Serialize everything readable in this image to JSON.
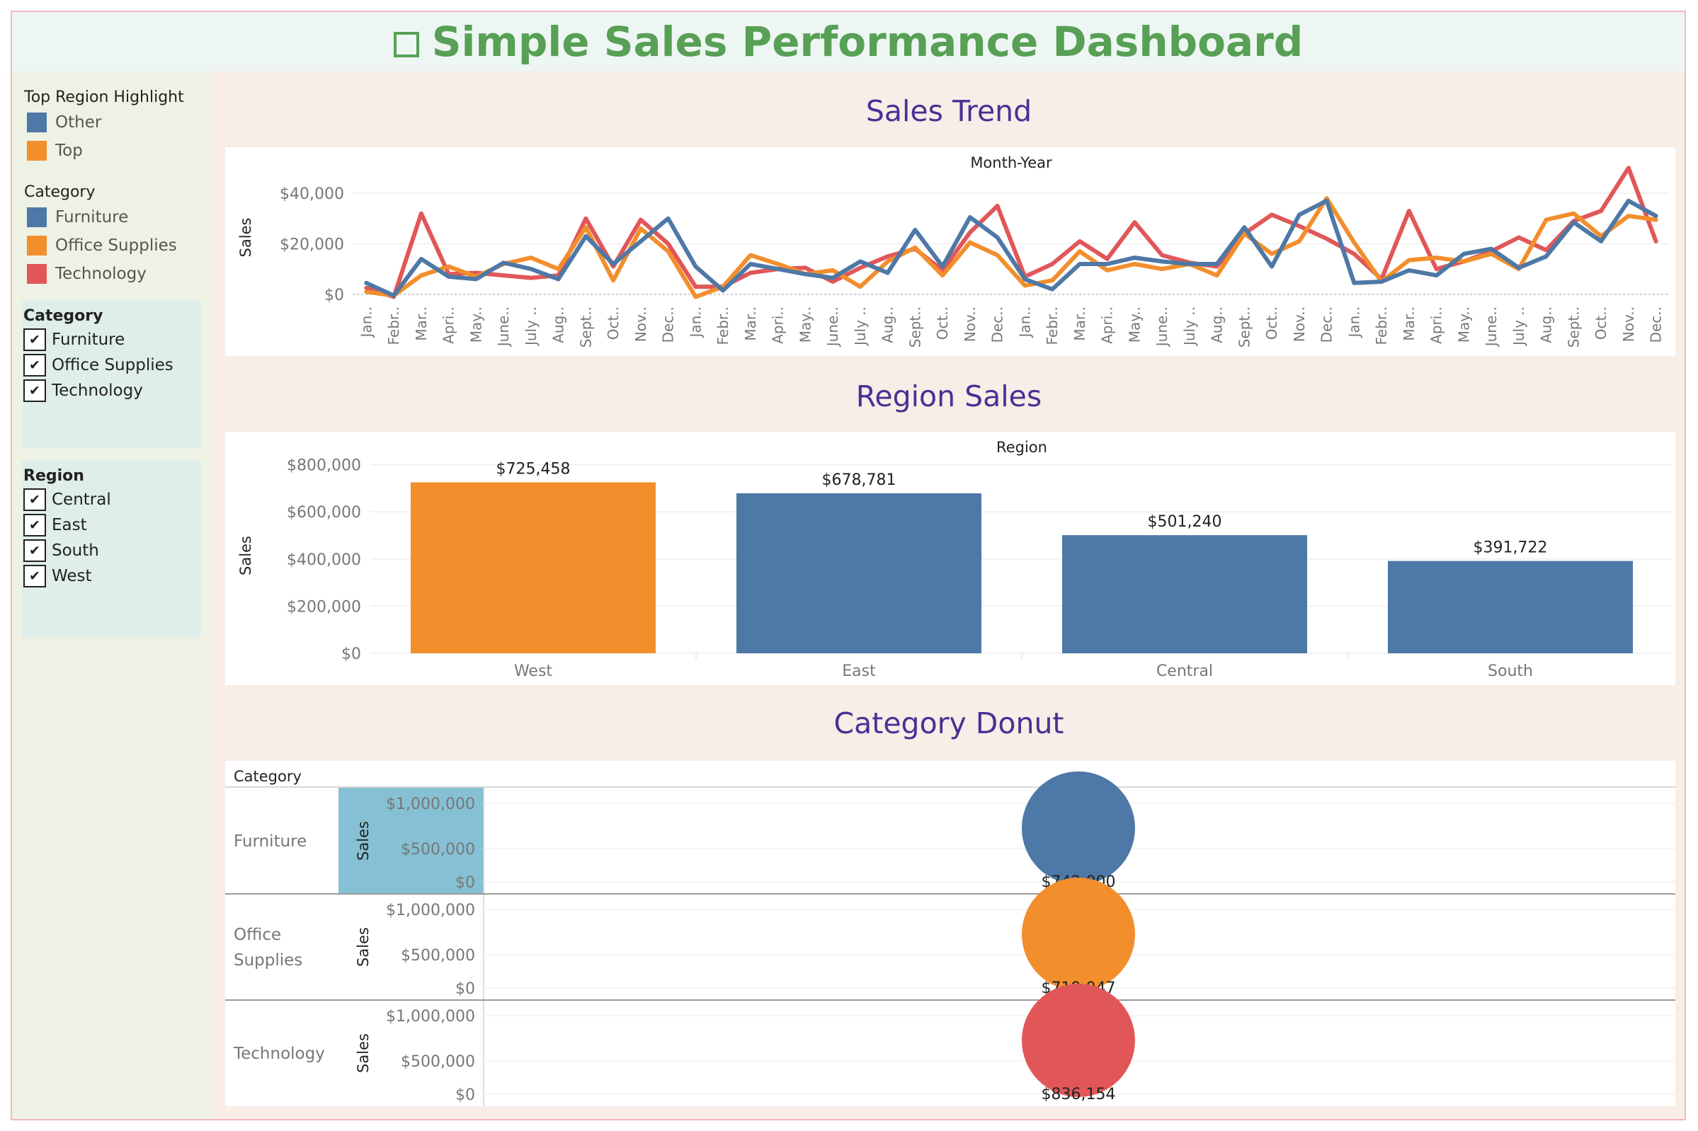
{
  "header": {
    "title": "Simple Sales Performance Dashboard",
    "icon": "checkbox-icon"
  },
  "sidebar": {
    "highlight_legend": {
      "title": "Top Region Highlight",
      "items": [
        {
          "label": "Other",
          "color": "#4e78a6"
        },
        {
          "label": "Top",
          "color": "#f28e2c"
        }
      ]
    },
    "category_legend": {
      "title": "Category",
      "items": [
        {
          "label": "Furniture",
          "color": "#4e78a6"
        },
        {
          "label": "Office Supplies",
          "color": "#f28e2c"
        },
        {
          "label": "Technology",
          "color": "#e15759"
        }
      ]
    },
    "category_filter": {
      "title": "Category",
      "items": [
        {
          "label": "Furniture",
          "checked": true
        },
        {
          "label": "Office Supplies",
          "checked": true
        },
        {
          "label": "Technology",
          "checked": true
        }
      ]
    },
    "region_filter": {
      "title": "Region",
      "items": [
        {
          "label": "Central",
          "checked": true
        },
        {
          "label": "East",
          "checked": true
        },
        {
          "label": "South",
          "checked": true
        },
        {
          "label": "West",
          "checked": true
        }
      ]
    }
  },
  "sections": {
    "trend_title": "Sales Trend",
    "region_title": "Region Sales",
    "donut_title": "Category Donut"
  },
  "chart_data": [
    {
      "type": "line",
      "title": "Sales Trend",
      "xlabel": "Month-Year",
      "ylabel": "Sales",
      "yticks": [
        "$40,000",
        "$20,000",
        "$0"
      ],
      "yticks_values": [
        40000,
        20000,
        0
      ],
      "ylim": [
        -2000,
        47000
      ],
      "x": [
        "Jan..",
        "Febr..",
        "Mar..",
        "Apri..",
        "May..",
        "June..",
        "July ..",
        "Aug..",
        "Sept..",
        "Oct..",
        "Nov..",
        "Dec..",
        "Jan..",
        "Febr..",
        "Mar..",
        "Apri..",
        "May..",
        "June..",
        "July ..",
        "Aug..",
        "Sept..",
        "Oct..",
        "Nov..",
        "Dec..",
        "Jan..",
        "Febr..",
        "Mar..",
        "Apri..",
        "May..",
        "June..",
        "July ..",
        "Aug..",
        "Sept..",
        "Oct..",
        "Nov..",
        "Dec..",
        "Jan..",
        "Febr..",
        "Mar..",
        "Apri..",
        "May..",
        "June..",
        "July ..",
        "Aug..",
        "Sept..",
        "Oct..",
        "Nov..",
        "Dec.."
      ],
      "series": [
        {
          "name": "Technology",
          "color": "#e15759",
          "values": [
            2500,
            -1000,
            32000,
            8000,
            8500,
            7500,
            6500,
            7500,
            30000,
            11000,
            29500,
            20000,
            3000,
            3000,
            8500,
            10000,
            10500,
            5000,
            10500,
            15000,
            18000,
            9500,
            24500,
            35000,
            7000,
            12000,
            21000,
            14000,
            28500,
            15500,
            12500,
            11000,
            24000,
            31500,
            27000,
            22000,
            16000,
            6000,
            33000,
            10000,
            13000,
            17000,
            22500,
            17500,
            29000,
            33000,
            50000,
            21000
          ]
        },
        {
          "name": "Office Supplies",
          "color": "#f28e2c",
          "values": [
            1000,
            -500,
            7500,
            11000,
            7000,
            12000,
            14500,
            10000,
            26500,
            5500,
            26000,
            17000,
            -1000,
            3000,
            15500,
            12000,
            8000,
            9500,
            3000,
            13000,
            18500,
            7500,
            20500,
            15500,
            3500,
            5500,
            17000,
            9500,
            12000,
            10000,
            12000,
            7500,
            24000,
            16000,
            21000,
            38000,
            20500,
            5000,
            13500,
            14500,
            13000,
            16000,
            10000,
            29500,
            32000,
            23000,
            31000,
            29500
          ]
        },
        {
          "name": "Furniture",
          "color": "#4e78a6",
          "values": [
            4500,
            -500,
            14000,
            7000,
            6000,
            12500,
            10000,
            6000,
            23000,
            12000,
            21000,
            30000,
            11000,
            1500,
            12000,
            10000,
            8000,
            6500,
            13000,
            8500,
            25500,
            11000,
            30500,
            22500,
            6000,
            2000,
            12000,
            12000,
            14500,
            13000,
            12000,
            12000,
            26500,
            11000,
            31500,
            37000,
            4500,
            5000,
            9500,
            7500,
            16000,
            18000,
            10500,
            15000,
            28500,
            21000,
            37000,
            31000
          ]
        }
      ]
    },
    {
      "type": "bar",
      "title": "Region Sales",
      "xlabel": "Region",
      "ylabel": "Sales",
      "categories": [
        "West",
        "East",
        "Central",
        "South"
      ],
      "values": [
        725458,
        678781,
        501240,
        391722
      ],
      "data_labels": [
        "$725,458",
        "$678,781",
        "$501,240",
        "$391,722"
      ],
      "colors": [
        "#f28e2c",
        "#4e78a6",
        "#4e78a6",
        "#4e78a6"
      ],
      "yticks": [
        "$800,000",
        "$600,000",
        "$400,000",
        "$200,000",
        "$0"
      ],
      "yticks_values": [
        800000,
        600000,
        400000,
        200000,
        0
      ],
      "ylim": [
        0,
        820000
      ]
    },
    {
      "type": "pie",
      "title": "Category Donut",
      "row_header": "Category",
      "ylabel": "Sales",
      "categories": [
        "Furniture",
        "Office Supplies",
        "Technology"
      ],
      "row_labels": [
        [
          "Furniture"
        ],
        [
          "Office",
          "Supplies"
        ],
        [
          "Technology"
        ]
      ],
      "values": [
        742000,
        719047,
        836154
      ],
      "data_labels": [
        "$742,000",
        "$719,047",
        "$836,154"
      ],
      "colors": [
        "#4e78a6",
        "#f28e2c",
        "#e15759"
      ],
      "yticks": [
        "$1,000,000",
        "$500,000",
        "$0"
      ]
    }
  ]
}
